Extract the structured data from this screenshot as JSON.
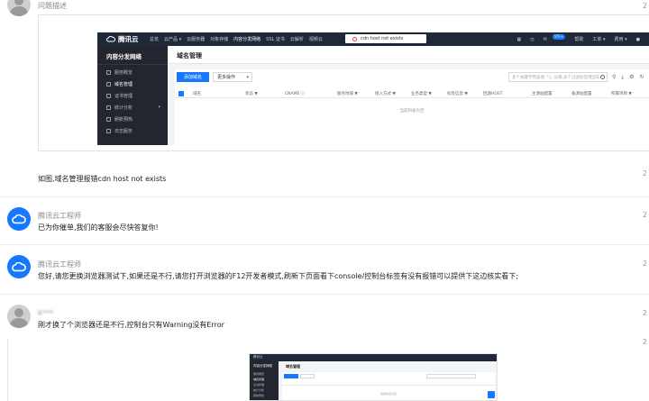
{
  "thread": {
    "header_label": "问题描述",
    "comments": [
      {
        "author": "腾讯云工程师",
        "text": "已为你催单,我们的客服会尽快答复你!",
        "reply_count": "2"
      },
      {
        "author": "腾讯云工程师",
        "text": "您好,请您更换浏览器测试下,如果还是不行,请您打开浏览器的F12开发者模式,刷新下页面看下console/控制台标签有没有报错可以提供下这边核实看下;",
        "reply_count": "2"
      },
      {
        "author": "K***",
        "text": "刚才换了个浏览器还是不行,控制台只有Warning没有Error",
        "reply_count": "2"
      }
    ],
    "description": "如图,域名管理报错cdn host not exists",
    "edge_numbers": [
      "2",
      "2",
      "2",
      "2"
    ]
  },
  "console": {
    "logo_text": "腾讯云",
    "nav": [
      "总览",
      "云产品 ▾",
      "云服务器",
      "对象存储",
      "内容分发网络",
      "SSL 证书",
      "云解析",
      "视频云"
    ],
    "active_nav": "内容分发网络",
    "top_right": [
      "▦",
      "◷",
      "✉",
      "帮助",
      "工单 ▾",
      "费用 ▾",
      "●"
    ],
    "badge": "99+",
    "toast": "cdn host not exists",
    "sidebar_title": "内容分发网络",
    "sidebar_items": [
      {
        "label": "服务概览",
        "active": false,
        "arrow": ""
      },
      {
        "label": "域名管理",
        "active": true,
        "arrow": ""
      },
      {
        "label": "证书管理",
        "active": false,
        "arrow": ""
      },
      {
        "label": "统计分析",
        "active": false,
        "arrow": "▾"
      },
      {
        "label": "刷新预热",
        "active": false,
        "arrow": ""
      },
      {
        "label": "日志服务",
        "active": false,
        "arrow": ""
      }
    ],
    "page_title": "域名管理",
    "add_button": "添加域名",
    "more_button": "更多操作",
    "search_placeholder": "多个关键字用竖线「|」分隔,多个过滤标签用回车键分隔",
    "toolbar_icons": [
      "⚲",
      "⤓",
      "⚙",
      "↻"
    ],
    "columns": [
      "域名",
      "状态 ▼",
      "CNAME ⓘ",
      "服务地域 ▼",
      "接入方式 ▼",
      "业务类型 ▼",
      "标签信息 ▼",
      "回源HOST",
      "主源站配置",
      "备源站配置",
      "所属项目 ▼"
    ],
    "empty_text": "当前列表为空"
  },
  "thumbnail": {
    "logo_text": "腾讯云",
    "sidebar_title": "内容分发网络",
    "sidebar_items": [
      "服务概览",
      "域名管理",
      "证书管理",
      "统计分析",
      "刷新预热"
    ],
    "page_title": "域名管理",
    "empty_text": "当前列表为空"
  }
}
